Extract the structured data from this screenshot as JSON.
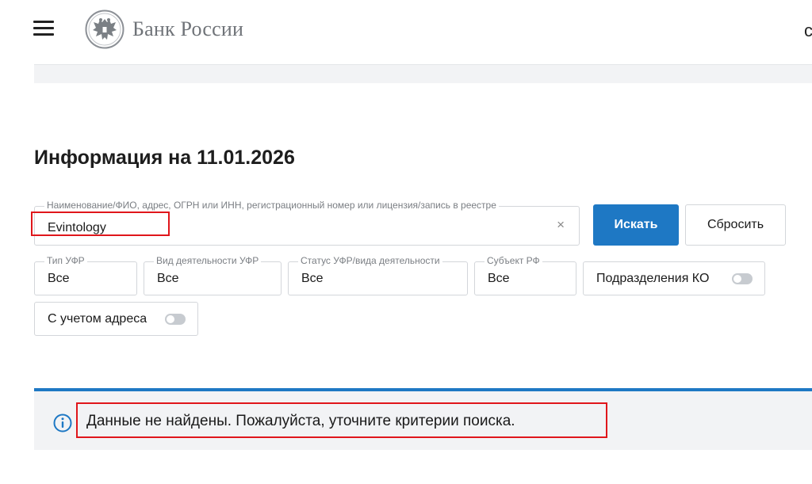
{
  "header": {
    "menu_icon": "hamburger-icon",
    "logo_icon": "double-headed-eagle-emblem",
    "logo_text": "Банк России",
    "edge_char": "c"
  },
  "page": {
    "title": "Информация на 11.01.2026"
  },
  "search": {
    "legend": "Наименование/ФИО, адрес, ОГРН или ИНН, регистрационный номер или лицензия/запись в реестре",
    "value": "Evintology",
    "clear_glyph": "×",
    "submit_label": "Искать",
    "reset_label": "Сбросить"
  },
  "filters": [
    {
      "legend": "Тип УФР",
      "value": "Все"
    },
    {
      "legend": "Вид деятельности УФР",
      "value": "Все"
    },
    {
      "legend": "Статус УФР/вида деятельности",
      "value": "Все"
    },
    {
      "legend": "Субъект РФ",
      "value": "Все"
    }
  ],
  "toggles": {
    "subdivisions_label": "Подразделения КО",
    "subdivisions_on": false,
    "address_label": "С учетом адреса",
    "address_on": false
  },
  "notice": {
    "icon": "info-icon",
    "text": "Данные не найдены. Пожалуйста, уточните критерии поиска."
  },
  "colors": {
    "accent": "#1e78c4",
    "highlight": "#e0161b",
    "band": "#f2f3f5"
  }
}
